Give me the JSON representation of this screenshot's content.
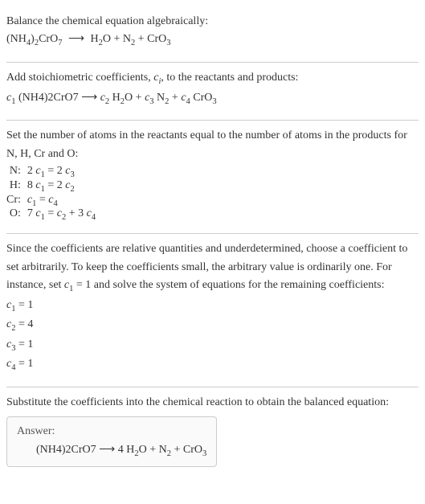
{
  "section1": {
    "title": "Balance the chemical equation algebraically:",
    "equation": "(NH₄)₂CrO₇  ⟶  H₂O + N₂ + CrO₃"
  },
  "section2": {
    "title_html": "Add stoichiometric coefficients, <span class=\"ital\">c<sub>i</sub></span>, to the reactants and products:",
    "equation_html": "<span class=\"ital\">c</span><sub>1</sub> (NH4)2CrO7  ⟶  <span class=\"ital\">c</span><sub>2</sub> H<sub>2</sub>O + <span class=\"ital\">c</span><sub>3</sub> N<sub>2</sub> + <span class=\"ital\">c</span><sub>4</sub> CrO<sub>3</sub>"
  },
  "section3": {
    "title": "Set the number of atoms in the reactants equal to the number of atoms in the products for N, H, Cr and O:",
    "rows": [
      {
        "label": "N:",
        "value_html": "2 <span class=\"ital\">c</span><sub>1</sub> = 2 <span class=\"ital\">c</span><sub>3</sub>"
      },
      {
        "label": "H:",
        "value_html": "8 <span class=\"ital\">c</span><sub>1</sub> = 2 <span class=\"ital\">c</span><sub>2</sub>"
      },
      {
        "label": "Cr:",
        "value_html": "<span class=\"ital\">c</span><sub>1</sub> = <span class=\"ital\">c</span><sub>4</sub>"
      },
      {
        "label": "O:",
        "value_html": "7 <span class=\"ital\">c</span><sub>1</sub> = <span class=\"ital\">c</span><sub>2</sub> + 3 <span class=\"ital\">c</span><sub>4</sub>"
      }
    ]
  },
  "section4": {
    "title_html": "Since the coefficients are relative quantities and underdetermined, choose a coefficient to set arbitrarily. To keep the coefficients small, the arbitrary value is ordinarily one. For instance, set <span class=\"ital\">c</span><sub>1</sub> = 1 and solve the system of equations for the remaining coefficients:",
    "lines_html": [
      "<span class=\"ital\">c</span><sub>1</sub> = 1",
      "<span class=\"ital\">c</span><sub>2</sub> = 4",
      "<span class=\"ital\">c</span><sub>3</sub> = 1",
      "<span class=\"ital\">c</span><sub>4</sub> = 1"
    ]
  },
  "section5": {
    "title": "Substitute the coefficients into the chemical reaction to obtain the balanced equation:",
    "answer_label": "Answer:",
    "answer_html": "(NH4)2CrO7  ⟶  4 H<sub>2</sub>O + N<sub>2</sub> + CrO<sub>3</sub>"
  },
  "chart_data": {
    "type": "table",
    "title": "Algebraic balancing of (NH4)2CrO7 → H2O + N2 + CrO3",
    "atom_equations": [
      {
        "element": "N",
        "equation": "2 c1 = 2 c3"
      },
      {
        "element": "H",
        "equation": "8 c1 = 2 c2"
      },
      {
        "element": "Cr",
        "equation": "c1 = c4"
      },
      {
        "element": "O",
        "equation": "7 c1 = c2 + 3 c4"
      }
    ],
    "solution": {
      "c1": 1,
      "c2": 4,
      "c3": 1,
      "c4": 1
    },
    "balanced_equation": "(NH4)2CrO7 → 4 H2O + N2 + CrO3"
  }
}
